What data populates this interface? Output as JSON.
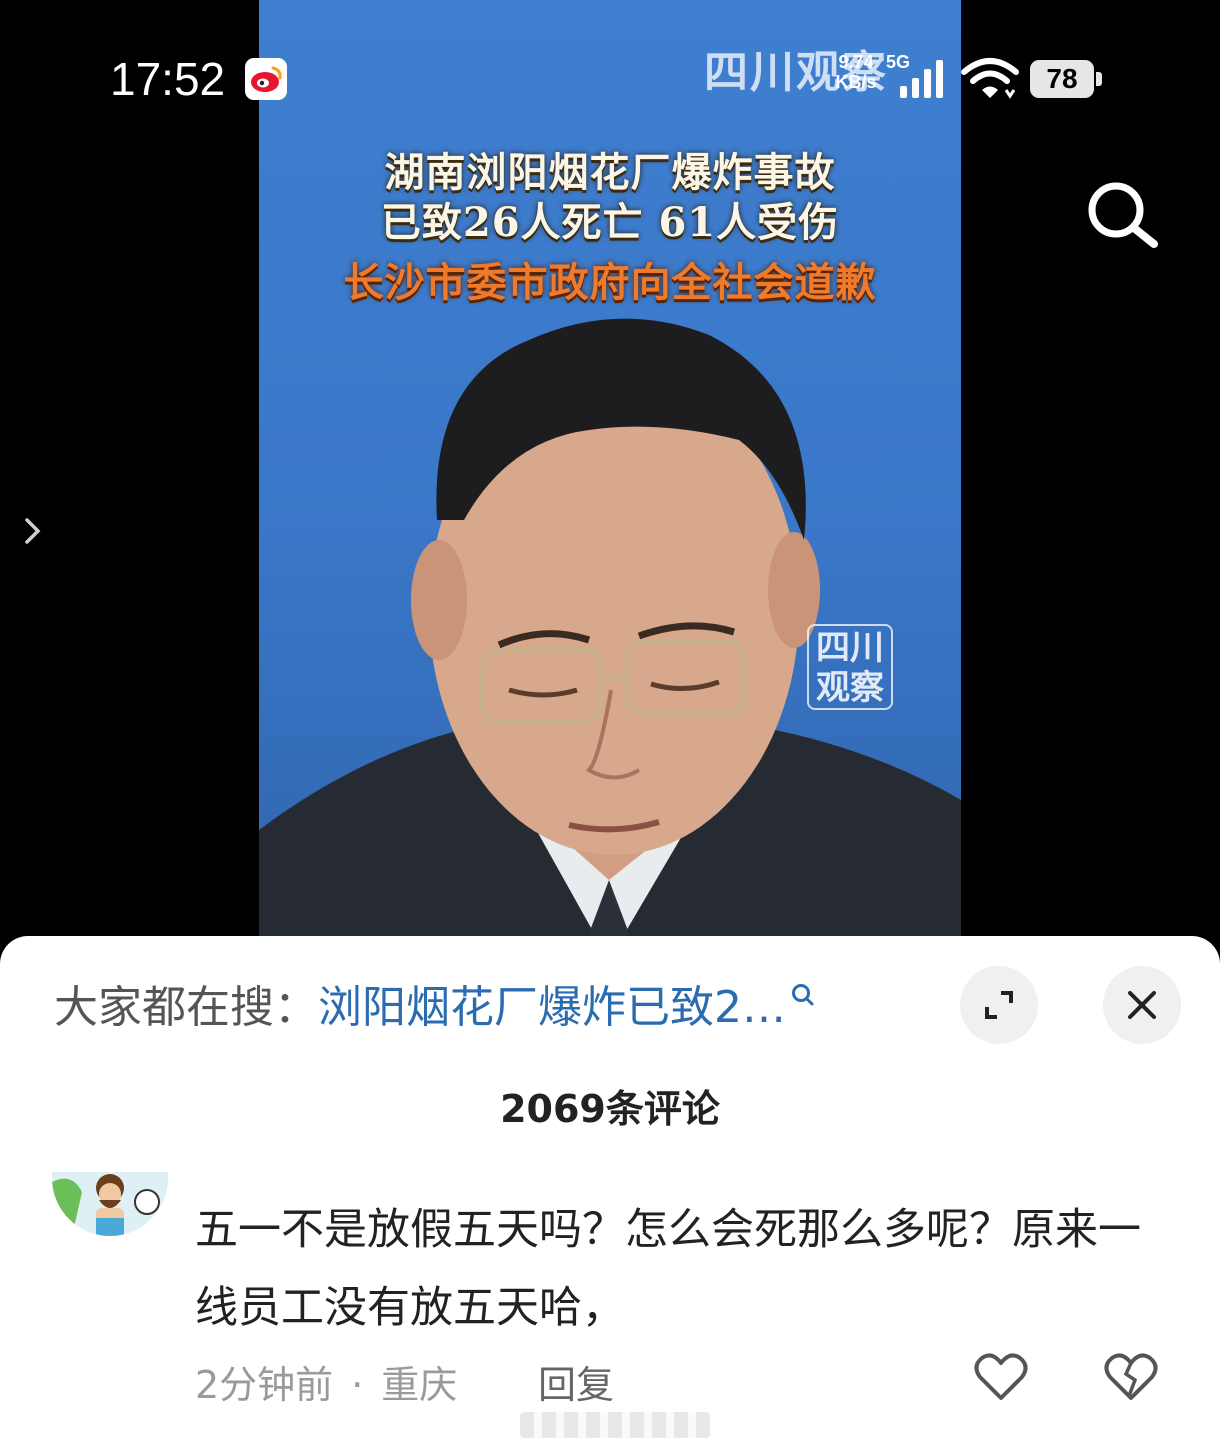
{
  "status_bar": {
    "time": "17:52",
    "net_speed_value": "9.74",
    "net_speed_unit": "KB/s",
    "net_type": "5G",
    "battery": "78",
    "icons": [
      "weibo-icon",
      "signal-icon",
      "wifi-icon"
    ]
  },
  "video": {
    "watermark_top": "四川观察",
    "caption_line1": "湖南浏阳烟花厂爆炸事故",
    "caption_line2": "已致26人死亡 61人受伤",
    "caption_line3": "长沙市委市政府向全社会道歉",
    "watermark_stamp_line1": "四川",
    "watermark_stamp_line2": "观察"
  },
  "sheet": {
    "trend_prefix": "大家都在搜：",
    "trend_link": "浏阳烟花厂爆炸已致2…",
    "comment_count": "2069条评论"
  },
  "comment": {
    "text": "五一不是放假五天吗？怎么会死那么多呢？原来一线员工没有放五天哈，",
    "time": "2分钟前",
    "separator": "·",
    "location": "重庆",
    "reply_label": "回复"
  },
  "colors": {
    "link": "#2b6cb0",
    "video_bg": "#3a77c8",
    "caption_highlight": "#f07a2c"
  }
}
